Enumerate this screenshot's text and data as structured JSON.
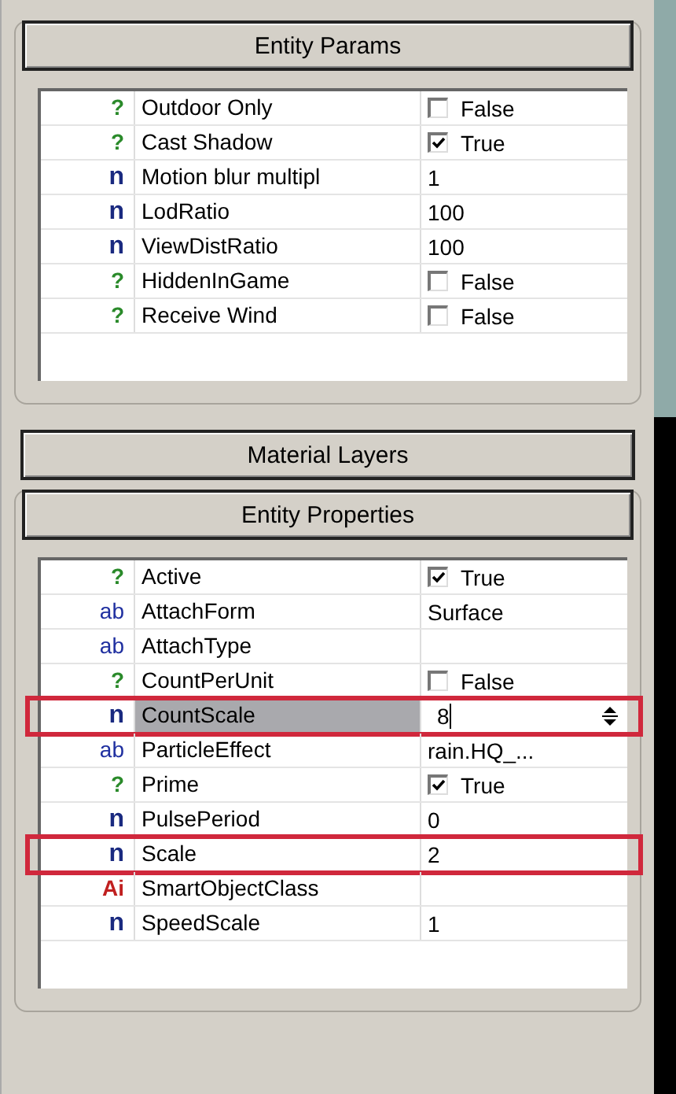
{
  "sections": [
    {
      "title": "Entity Params",
      "expanded": true,
      "rows": [
        {
          "kind": "bool",
          "icon": "?",
          "name": "Outdoor Only",
          "value": "False",
          "checked": false,
          "selected": false,
          "highlighted": false
        },
        {
          "kind": "bool",
          "icon": "?",
          "name": "Cast Shadow",
          "value": "True",
          "checked": true,
          "selected": false,
          "highlighted": false
        },
        {
          "kind": "number",
          "icon": "n",
          "name": "Motion blur multipl",
          "value": "1",
          "selected": false,
          "highlighted": false
        },
        {
          "kind": "number",
          "icon": "n",
          "name": "LodRatio",
          "value": "100",
          "selected": false,
          "highlighted": false
        },
        {
          "kind": "number",
          "icon": "n",
          "name": "ViewDistRatio",
          "value": "100",
          "selected": false,
          "highlighted": false
        },
        {
          "kind": "bool",
          "icon": "?",
          "name": "HiddenInGame",
          "value": "False",
          "checked": false,
          "selected": false,
          "highlighted": false
        },
        {
          "kind": "bool",
          "icon": "?",
          "name": "Receive Wind",
          "value": "False",
          "checked": false,
          "selected": false,
          "highlighted": false
        }
      ]
    },
    {
      "title": "Material Layers",
      "expanded": false
    },
    {
      "title": "Entity Properties",
      "expanded": true,
      "rows": [
        {
          "kind": "bool",
          "icon": "?",
          "name": "Active",
          "value": "True",
          "checked": true,
          "selected": false,
          "highlighted": false
        },
        {
          "kind": "string",
          "icon": "ab",
          "name": "AttachForm",
          "value": "Surface",
          "selected": false,
          "highlighted": false
        },
        {
          "kind": "string",
          "icon": "ab",
          "name": "AttachType",
          "selected": false,
          "highlighted": false
        },
        {
          "kind": "bool",
          "icon": "?",
          "name": "CountPerUnit",
          "value": "False",
          "checked": false,
          "selected": false,
          "highlighted": false
        },
        {
          "kind": "number",
          "icon": "n",
          "name": "CountScale",
          "value": "8",
          "selected": true,
          "highlighted": true
        },
        {
          "kind": "string",
          "icon": "ab",
          "name": "ParticleEffect",
          "value": "rain.HQ_...",
          "selected": false,
          "highlighted": false
        },
        {
          "kind": "bool",
          "icon": "?",
          "name": "Prime",
          "value": "True",
          "checked": true,
          "selected": false,
          "highlighted": false
        },
        {
          "kind": "number",
          "icon": "n",
          "name": "PulsePeriod",
          "value": "0",
          "selected": false,
          "highlighted": false
        },
        {
          "kind": "number",
          "icon": "n",
          "name": "Scale",
          "value": "2",
          "selected": false,
          "highlighted": true
        },
        {
          "kind": "ai",
          "icon": "Ai",
          "name": "SmartObjectClass",
          "selected": false,
          "highlighted": false
        },
        {
          "kind": "number",
          "icon": "n",
          "name": "SpeedScale",
          "value": "1",
          "selected": false,
          "highlighted": false
        }
      ]
    }
  ]
}
